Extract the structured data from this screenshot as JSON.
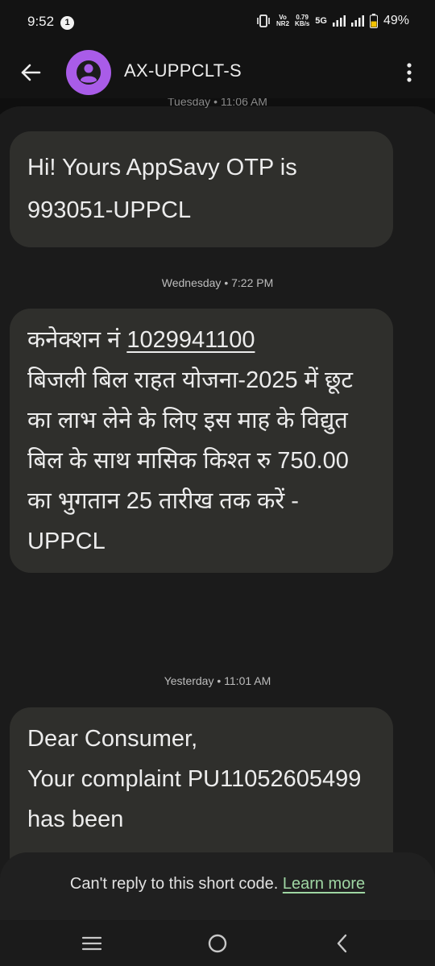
{
  "status_bar": {
    "time": "9:52",
    "notification_count": "1",
    "net_type_top": "Vo",
    "net_type_bottom": "NR2",
    "speed_value": "0.79",
    "speed_unit": "KB/s",
    "network": "5G",
    "battery": "49%"
  },
  "header": {
    "contact_name": "AX-UPPCLT-S",
    "icons": [
      "back-arrow-icon",
      "person-icon",
      "more-vert-icon"
    ],
    "avatar_color": "#a95ce8"
  },
  "conversation": {
    "partial_timestamp": "Tuesday • 11:06 AM",
    "messages": [
      {
        "text": "Hi! Yours AppSavy OTP is 993051-UPPCL"
      },
      {
        "timestamp": "Wednesday • 7:22 PM",
        "prefix": "कनेक्शन नं ",
        "connection_number": "1029941100",
        "body": "बिजली बिल राहत योजना-2025 में छूट का लाभ लेने के लिए इस माह के विद्युत बिल के साथ मासिक किश्त रु 750.00 का भुगतान 25 तारीख तक करें -UPPCL"
      },
      {
        "timestamp": "Yesterday • 11:01 AM",
        "text": "Dear Consumer,\nYour complaint PU11052605499 has been"
      }
    ]
  },
  "reply_note": {
    "text": "Can't reply to this short code. ",
    "link": "Learn more",
    "link_color": "#9fd6a3"
  },
  "nav_bar": {
    "icons": [
      "recents-icon",
      "home-icon",
      "back-icon"
    ]
  }
}
